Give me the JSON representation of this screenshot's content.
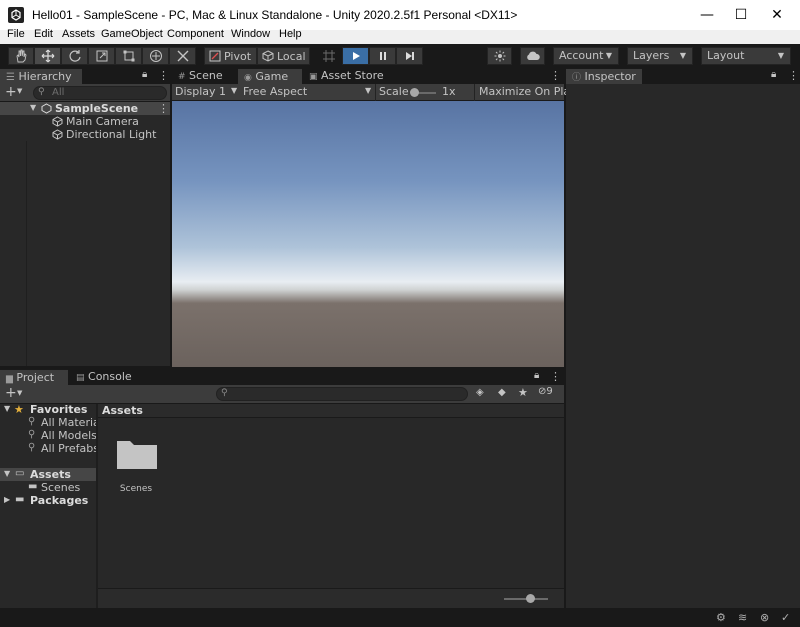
{
  "window": {
    "title": "Hello01 - SampleScene - PC, Mac & Linux Standalone - Unity 2020.2.5f1 Personal <DX11>",
    "minimize": "—",
    "maximize": "☐",
    "close": "✕"
  },
  "menu": [
    "File",
    "Edit",
    "Assets",
    "GameObject",
    "Component",
    "Window",
    "Help"
  ],
  "toolbar": {
    "pivot": "Pivot",
    "local": "Local",
    "account": "Account",
    "layers": "Layers",
    "layout": "Layout"
  },
  "hierarchy": {
    "tab": "Hierarchy",
    "search_placeholder": "All",
    "scene": "SampleScene",
    "items": [
      "Main Camera",
      "Directional Light"
    ]
  },
  "center_tabs": [
    "Scene",
    "Game",
    "Asset Store"
  ],
  "game_bar": {
    "display": "Display 1",
    "aspect": "Free Aspect",
    "scale_label": "Scale",
    "scale_value": "1x",
    "maximize": "Maximize On Play"
  },
  "inspector": {
    "tab": "Inspector"
  },
  "bottom_tabs": [
    "Project",
    "Console"
  ],
  "project": {
    "hidden_count": "9",
    "favorites_label": "Favorites",
    "favorites": [
      "All Materials",
      "All Models",
      "All Prefabs"
    ],
    "assets_label": "Assets",
    "asset_children": [
      "Scenes"
    ],
    "packages_label": "Packages",
    "breadcrumb": "Assets",
    "grid_items": [
      "Scenes"
    ]
  },
  "colors": {
    "sky_top": "#5873a2",
    "horizon": "#e8edf2",
    "ground": "#6b625d",
    "accent_blue": "#3a72b0"
  }
}
